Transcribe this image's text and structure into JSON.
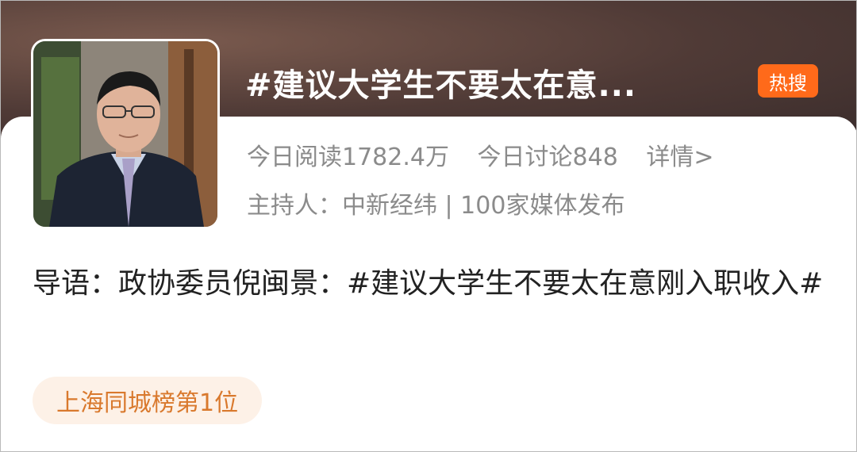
{
  "topic": {
    "title": "#建议大学生不要太在意...",
    "badge": "热搜",
    "stats": {
      "reads": "今日阅读1782.4万",
      "discussions": "今日讨论848",
      "details_link": "详情>"
    },
    "host_line": "主持人：中新经纬 | 100家媒体发布"
  },
  "lead": {
    "text": "导语：政协委员倪闽景：#建议大学生不要太在意刚入职收入#"
  },
  "rank_tag": "上海同城榜第1位"
}
